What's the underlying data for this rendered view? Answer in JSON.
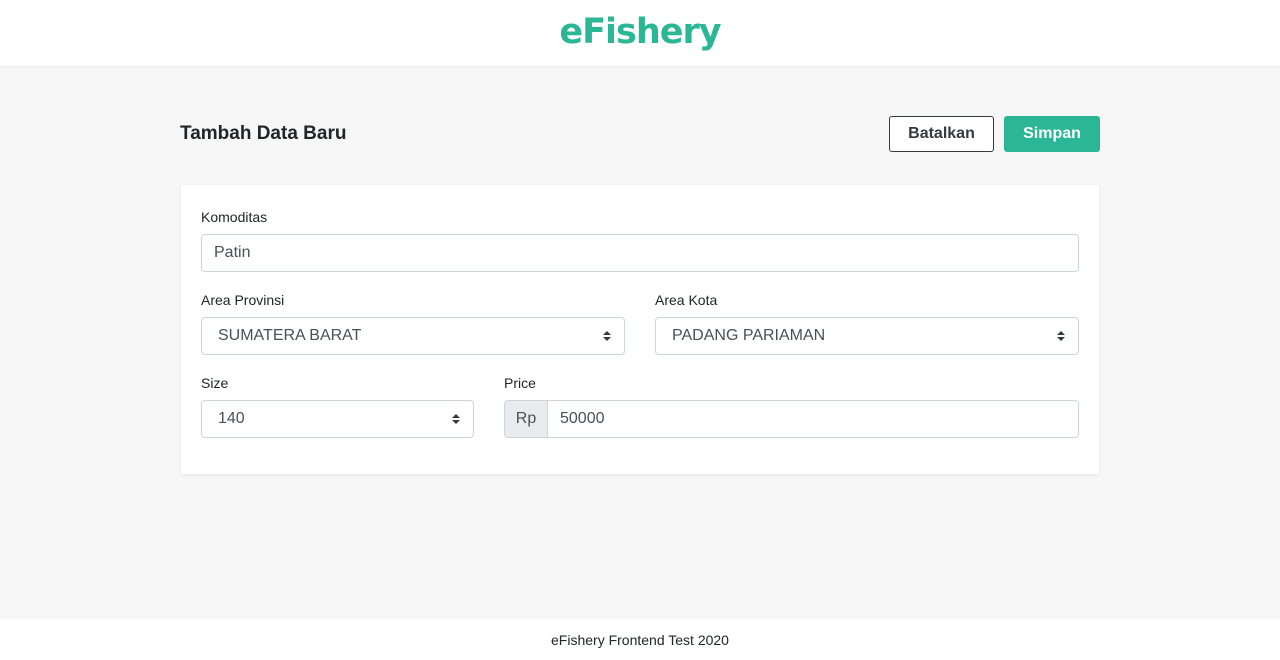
{
  "brand": {
    "logo_text": "eFishery",
    "color": "#2bb795"
  },
  "page": {
    "title": "Tambah Data Baru",
    "cancel_label": "Batalkan",
    "save_label": "Simpan"
  },
  "form": {
    "komoditas": {
      "label": "Komoditas",
      "value": "Patin"
    },
    "area_provinsi": {
      "label": "Area Provinsi",
      "value": "SUMATERA BARAT"
    },
    "area_kota": {
      "label": "Area Kota",
      "value": "PADANG PARIAMAN"
    },
    "size": {
      "label": "Size",
      "value": "140"
    },
    "price": {
      "label": "Price",
      "prefix": "Rp",
      "value": "50000"
    }
  },
  "footer": {
    "text": "eFishery Frontend Test 2020"
  },
  "icons": {
    "select_caret": "sort-caret-icon"
  }
}
